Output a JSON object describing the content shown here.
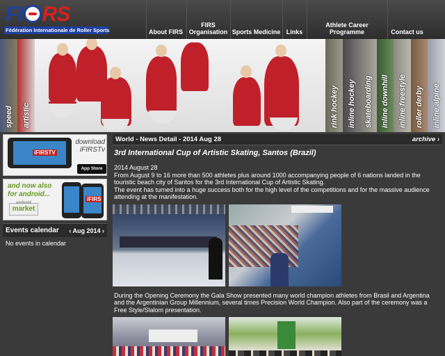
{
  "logo": {
    "mark_left": "FI",
    "mark_right": "RS",
    "subtitle": "Fédération Internationale de Roller Sports"
  },
  "nav": {
    "items": [
      {
        "label": "About FIRS"
      },
      {
        "label": "FIRS Organisation"
      },
      {
        "label": "Sports Medicine"
      },
      {
        "label": "Links"
      },
      {
        "label": "Athlete Career Programme"
      },
      {
        "label": "Contact us"
      }
    ]
  },
  "banner": {
    "left_tabs": [
      {
        "label": "speed",
        "color": "#5a6e8a"
      },
      {
        "label": "artistic",
        "color": "#a03030"
      }
    ],
    "right_tabs": [
      {
        "label": "rink hockey",
        "color": "#7a7a6a"
      },
      {
        "label": "inline hockey",
        "color": "#5a5a5a"
      },
      {
        "label": "skateboarding",
        "color": "#8a8a80"
      },
      {
        "label": "inline downhill",
        "color": "#4a6a40"
      },
      {
        "label": "inline freestyle",
        "color": "#9a9a90"
      },
      {
        "label": "roller derby",
        "color": "#8a6a50"
      },
      {
        "label": "inline alpine",
        "color": "#b0b0b8"
      }
    ]
  },
  "sidebar": {
    "ios_promo": {
      "title_line1": "download",
      "title_line2": "iFIRSTv",
      "badge": "iFIRSTV",
      "store": "App Store"
    },
    "android_promo": {
      "title_line1": "and now also",
      "title_line2": "for android...",
      "store_small": "android",
      "store": "market",
      "badge": "iFIRS"
    },
    "calendar": {
      "title": "Events calendar",
      "month": "‹ Aug 2014 ›",
      "empty_text": "No events in calendar"
    }
  },
  "main": {
    "section": "World - News Detail - 2014 Aug 28",
    "archive": "archive ›",
    "headline": "3rd International Cup of Artistic Skating, Santos (Brazil)",
    "date": "2014 August 28",
    "paragraph1": "From August 9 to 16 more than 500 athletes plus around 1000 accompanying people of 6 nations landed in the touristic beach city of Santos for the 3rd International Cup of Artistic Skating.",
    "paragraph2": "The event has turned into a huge success both for the high level of the competitions and for the massive audience attending at the manifestation.",
    "caption": "During the Opening Ceremony the Gala Show presented many world champion athletes from Brasil and Argentina and the Argentinian Group Millennium, several times Precision World Champion. Also part of the ceremony was a Free Style/Slalom presentation."
  },
  "colors": {
    "background": "#3a3a3a",
    "logo_blue": "#1f3f9e",
    "logo_red": "#d82020"
  }
}
